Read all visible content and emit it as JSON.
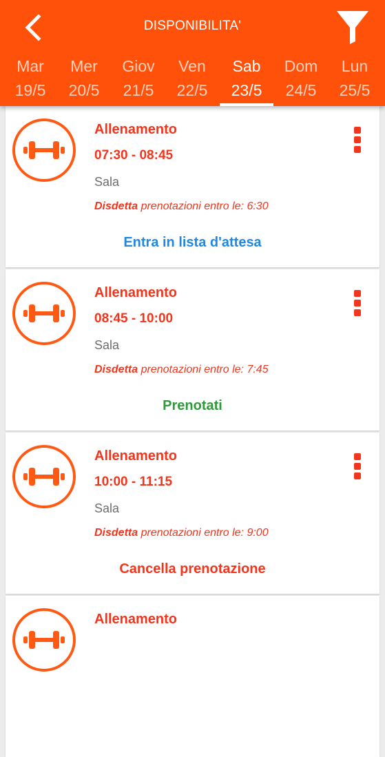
{
  "header": {
    "title": "DISPONIBILITA'",
    "back_icon": "chevron-left-icon",
    "filter_icon": "filter-funnel-icon",
    "accent_color": "#ff5109"
  },
  "days": [
    {
      "name": "Mar",
      "date": "19/5",
      "active": false
    },
    {
      "name": "Mer",
      "date": "20/5",
      "active": false
    },
    {
      "name": "Giov",
      "date": "21/5",
      "active": false
    },
    {
      "name": "Ven",
      "date": "22/5",
      "active": false
    },
    {
      "name": "Sab",
      "date": "23/5",
      "active": true
    },
    {
      "name": "Dom",
      "date": "24/5",
      "active": false
    },
    {
      "name": "Lun",
      "date": "25/5",
      "active": false
    }
  ],
  "slots": [
    {
      "title": "Allenamento",
      "time": "07:30 - 08:45",
      "room": "Sala",
      "note_bold": "Disdetta",
      "note_text": " prenotazioni entro le: 6:30",
      "action": "Entra in lista d'attesa",
      "action_color": "#1e88e5"
    },
    {
      "title": "Allenamento",
      "time": "08:45 - 10:00",
      "room": "Sala",
      "note_bold": "Disdetta",
      "note_text": " prenotazioni entro le: 7:45",
      "action": "Prenotati",
      "action_color": "#2e9b3a"
    },
    {
      "title": "Allenamento",
      "time": "10:00 - 11:15",
      "room": "Sala",
      "note_bold": "Disdetta",
      "note_text": " prenotazioni entro le: 9:00",
      "action": "Cancella prenotazione",
      "action_color": "#f2351d"
    },
    {
      "title": "Allenamento",
      "time": "",
      "room": "",
      "note_bold": "",
      "note_text": "",
      "action": "",
      "action_color": "#f2351d"
    }
  ],
  "icons": {
    "slot_icon": "dumbbell-icon",
    "menu_icon": "more-vertical-icon"
  }
}
